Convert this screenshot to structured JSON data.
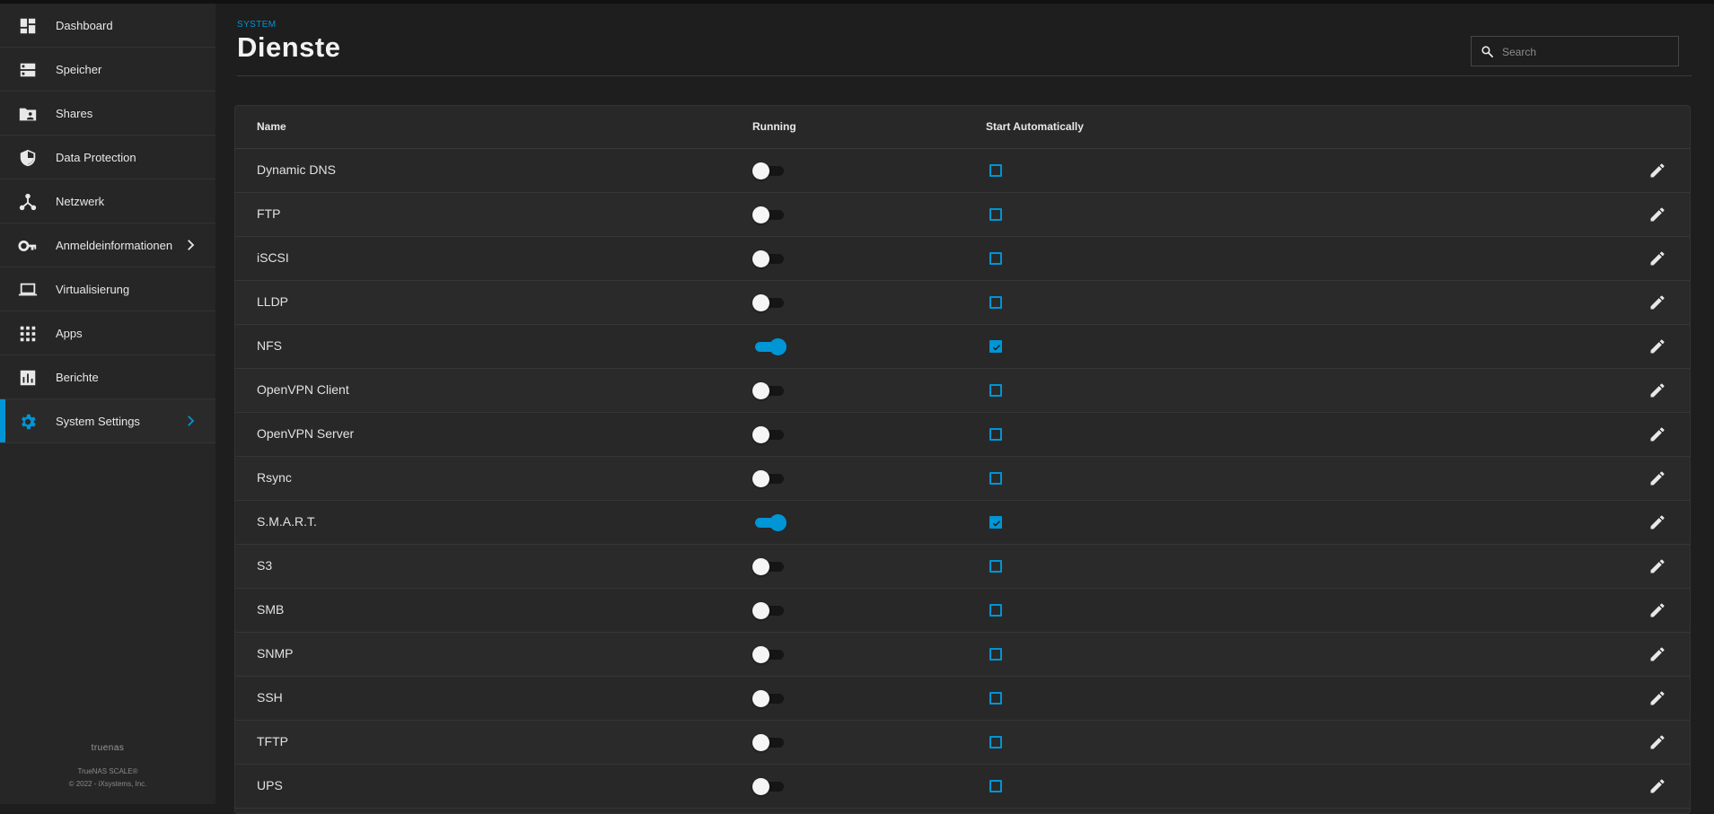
{
  "sidebar": {
    "items": [
      {
        "label": "Dashboard",
        "icon": "dashboard-icon",
        "active": false,
        "chevron": false
      },
      {
        "label": "Speicher",
        "icon": "storage-icon",
        "active": false,
        "chevron": false
      },
      {
        "label": "Shares",
        "icon": "folder-share-icon",
        "active": false,
        "chevron": false
      },
      {
        "label": "Data Protection",
        "icon": "shield-icon",
        "active": false,
        "chevron": false
      },
      {
        "label": "Netzwerk",
        "icon": "network-icon",
        "active": false,
        "chevron": false
      },
      {
        "label": "Anmeldeinformationen",
        "icon": "key-icon",
        "active": false,
        "chevron": true
      },
      {
        "label": "Virtualisierung",
        "icon": "laptop-icon",
        "active": false,
        "chevron": false
      },
      {
        "label": "Apps",
        "icon": "apps-grid-icon",
        "active": false,
        "chevron": false
      },
      {
        "label": "Berichte",
        "icon": "reports-icon",
        "active": false,
        "chevron": false
      },
      {
        "label": "System Settings",
        "icon": "gear-icon",
        "active": true,
        "chevron": true
      }
    ],
    "footer": {
      "brand": "truenas",
      "product": "TrueNAS SCALE®",
      "copyright": "© 2022 - iXsystems, Inc."
    }
  },
  "header": {
    "breadcrumb": "SYSTEM",
    "title": "Dienste"
  },
  "search": {
    "placeholder": "Search"
  },
  "table": {
    "columns": {
      "name": "Name",
      "running": "Running",
      "start_automatically": "Start Automatically"
    },
    "rows": [
      {
        "name": "Dynamic DNS",
        "running": false,
        "start_automatically": false
      },
      {
        "name": "FTP",
        "running": false,
        "start_automatically": false
      },
      {
        "name": "iSCSI",
        "running": false,
        "start_automatically": false
      },
      {
        "name": "LLDP",
        "running": false,
        "start_automatically": false
      },
      {
        "name": "NFS",
        "running": true,
        "start_automatically": true
      },
      {
        "name": "OpenVPN Client",
        "running": false,
        "start_automatically": false
      },
      {
        "name": "OpenVPN Server",
        "running": false,
        "start_automatically": false
      },
      {
        "name": "Rsync",
        "running": false,
        "start_automatically": false
      },
      {
        "name": "S.M.A.R.T.",
        "running": true,
        "start_automatically": true
      },
      {
        "name": "S3",
        "running": false,
        "start_automatically": false
      },
      {
        "name": "SMB",
        "running": false,
        "start_automatically": false
      },
      {
        "name": "SNMP",
        "running": false,
        "start_automatically": false
      },
      {
        "name": "SSH",
        "running": false,
        "start_automatically": false
      },
      {
        "name": "TFTP",
        "running": false,
        "start_automatically": false
      },
      {
        "name": "UPS",
        "running": false,
        "start_automatically": false
      }
    ]
  },
  "colors": {
    "accent": "#0095d5",
    "background": "#1e1e1e",
    "sidebar": "#262626",
    "card": "#282828"
  }
}
